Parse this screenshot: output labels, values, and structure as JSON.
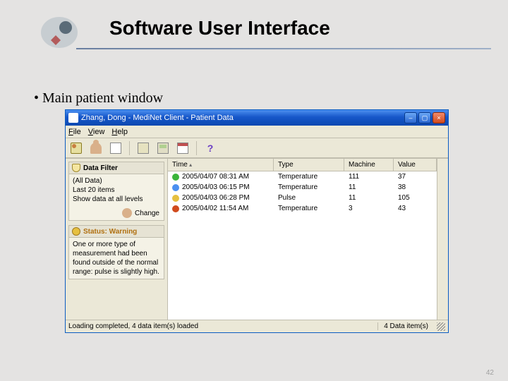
{
  "slide": {
    "title": "Software User Interface",
    "bullet": "Main patient window",
    "page_number": "42"
  },
  "window": {
    "title": "Zhang, Dong - MediNet Client - Patient Data",
    "menu": {
      "file": "File",
      "view": "View",
      "help": "Help"
    }
  },
  "sidebar": {
    "filter": {
      "title": "Data Filter",
      "line1": "(All Data)",
      "line2": "Last 20 items",
      "line3": "Show data at all levels",
      "change": "Change"
    },
    "status": {
      "title": "Status: Warning",
      "body": "One or more type of measurement had been found outside of the normal range: pulse is slightly high."
    }
  },
  "columns": {
    "time": "Time",
    "type": "Type",
    "machine": "Machine",
    "value": "Value"
  },
  "rows": [
    {
      "dot": "green",
      "time": "2005/04/07 08:31 AM",
      "type": "Temperature",
      "machine": "111",
      "value": "37"
    },
    {
      "dot": "blue",
      "time": "2005/04/03 06:15 PM",
      "type": "Temperature",
      "machine": "11",
      "value": "38"
    },
    {
      "dot": "yellow",
      "time": "2005/04/03 06:28 PM",
      "type": "Pulse",
      "machine": "11",
      "value": "105"
    },
    {
      "dot": "red",
      "time": "2005/04/02 11:54 AM",
      "type": "Temperature",
      "machine": "3",
      "value": "43"
    }
  ],
  "statusbar": {
    "left": "Loading completed, 4 data item(s) loaded",
    "right": "4 Data item(s)"
  }
}
